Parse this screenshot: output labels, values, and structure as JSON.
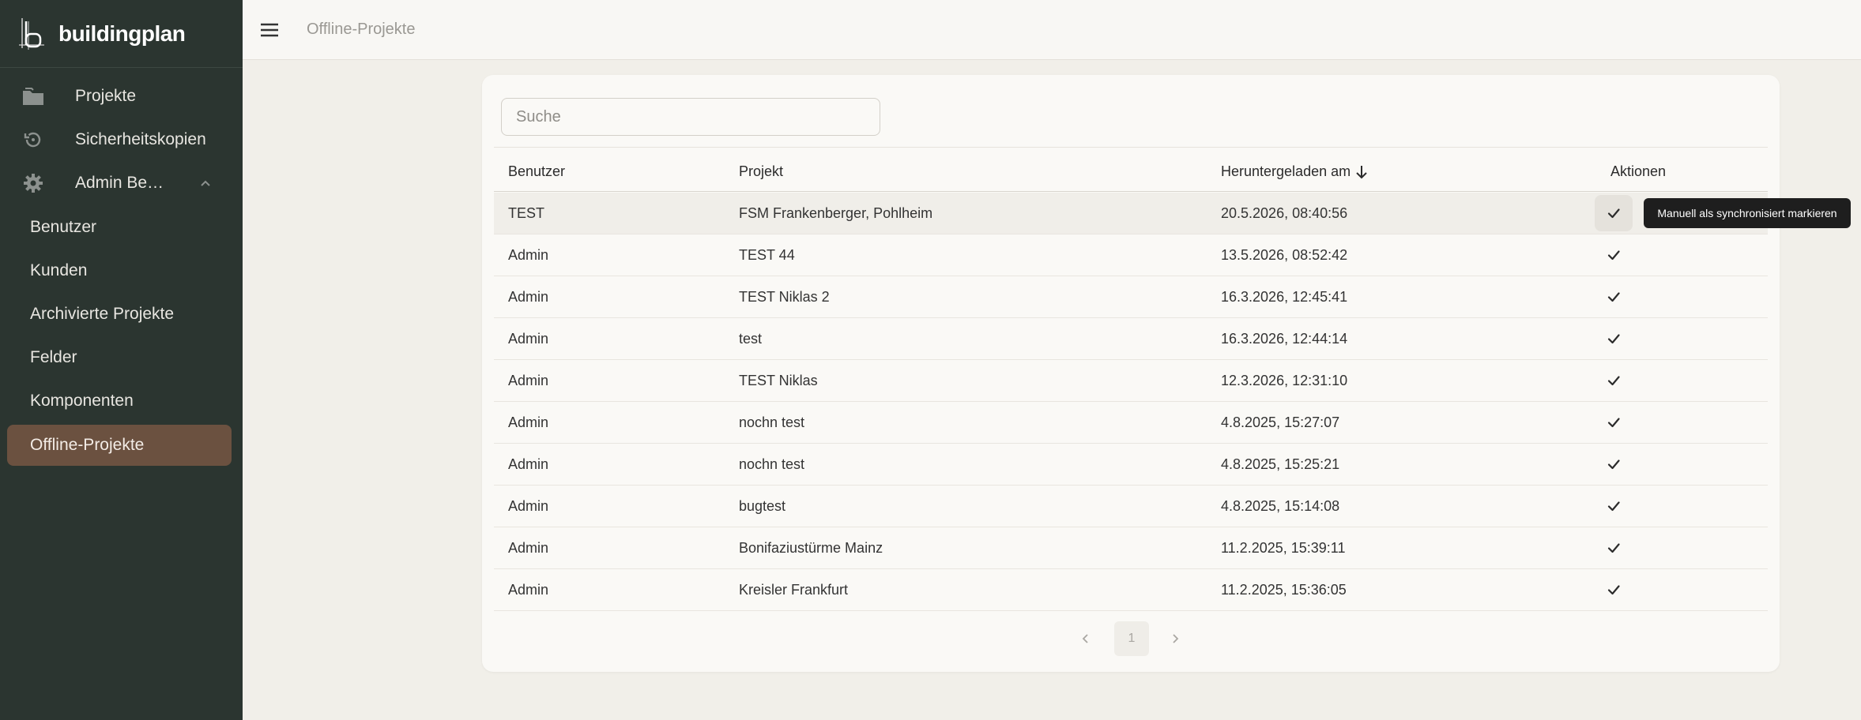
{
  "brand": {
    "name": "buildingplan",
    "logo_icon": "building-plan-logo-icon"
  },
  "sidebar": {
    "items": [
      {
        "label": "Projekte",
        "icon": "folder-icon"
      },
      {
        "label": "Sicherheitskopien",
        "icon": "history-icon"
      },
      {
        "label": "Admin Be…",
        "icon": "gear-icon",
        "expanded": true
      }
    ],
    "subitems": [
      {
        "label": "Benutzer"
      },
      {
        "label": "Kunden"
      },
      {
        "label": "Archivierte Projekte"
      },
      {
        "label": "Felder"
      },
      {
        "label": "Komponenten"
      },
      {
        "label": "Offline-Projekte",
        "active": true
      }
    ]
  },
  "topbar": {
    "breadcrumb": "Offline-Projekte",
    "menu_icon": "hamburger-icon"
  },
  "search": {
    "placeholder": "Suche",
    "value": ""
  },
  "table": {
    "columns": [
      "Benutzer",
      "Projekt",
      "Heruntergeladen am",
      "Aktionen"
    ],
    "sort": {
      "column": "Heruntergeladen am",
      "direction": "desc"
    },
    "rows": [
      {
        "user": "TEST",
        "project": "FSM Frankenberger, Pohlheim",
        "downloaded": "20.5.2026, 08:40:56"
      },
      {
        "user": "Admin",
        "project": "TEST 44",
        "downloaded": "13.5.2026, 08:52:42"
      },
      {
        "user": "Admin",
        "project": "TEST Niklas 2",
        "downloaded": "16.3.2026, 12:45:41"
      },
      {
        "user": "Admin",
        "project": "test",
        "downloaded": "16.3.2026, 12:44:14"
      },
      {
        "user": "Admin",
        "project": "TEST Niklas",
        "downloaded": "12.3.2026, 12:31:10"
      },
      {
        "user": "Admin",
        "project": "nochn test",
        "downloaded": "4.8.2025, 15:27:07"
      },
      {
        "user": "Admin",
        "project": "nochn test",
        "downloaded": "4.8.2025, 15:25:21"
      },
      {
        "user": "Admin",
        "project": "bugtest",
        "downloaded": "4.8.2025, 15:14:08"
      },
      {
        "user": "Admin",
        "project": "Bonifaziustürme Mainz",
        "downloaded": "11.2.2025, 15:39:11"
      },
      {
        "user": "Admin",
        "project": "Kreisler Frankfurt",
        "downloaded": "11.2.2025, 15:36:05"
      }
    ]
  },
  "tooltip": {
    "text": "Manuell als synchronisiert markieren"
  },
  "pagination": {
    "current_page": "1"
  },
  "colors": {
    "sidebar_bg": "#2b3530",
    "active_item_bg": "#6b5140",
    "page_bg": "#f1efe9",
    "card_bg": "#faf9f6"
  }
}
